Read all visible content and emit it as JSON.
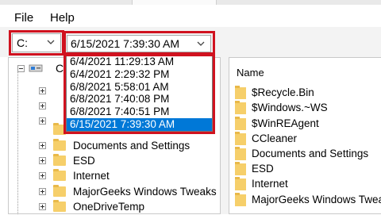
{
  "menu": {
    "items": [
      "File",
      "Help"
    ]
  },
  "toolbar": {
    "drive_selected": "C:",
    "date_selected": "6/15/2021 7:39:30 AM",
    "date_options": [
      "6/4/2021 11:29:13 AM",
      "6/4/2021 2:29:32 PM",
      "6/8/2021 5:58:01 AM",
      "6/8/2021 7:40:08 PM",
      "6/8/2021 7:40:51 PM",
      "6/15/2021 7:39:30 AM"
    ],
    "highlight_color": "#d0121f",
    "selection_color": "#0078d7"
  },
  "tree": {
    "root_label": "C:",
    "items": [
      "Documents and Settings",
      "ESD",
      "Internet",
      "MajorGeeks Windows Tweaks",
      "OneDriveTemp"
    ],
    "partial_item": "CCleaner"
  },
  "files": {
    "column_header": "Name",
    "items": [
      "$Recycle.Bin",
      "$Windows.~WS",
      "$WinREAgent",
      "CCleaner",
      "Documents and Settings",
      "ESD",
      "Internet",
      "MajorGeeks Windows Tweaks"
    ]
  },
  "icons": {
    "folder": "folder-icon",
    "drive": "drive-icon",
    "expand": "expand-plus-icon",
    "dropdown": "chevron-down-icon"
  }
}
